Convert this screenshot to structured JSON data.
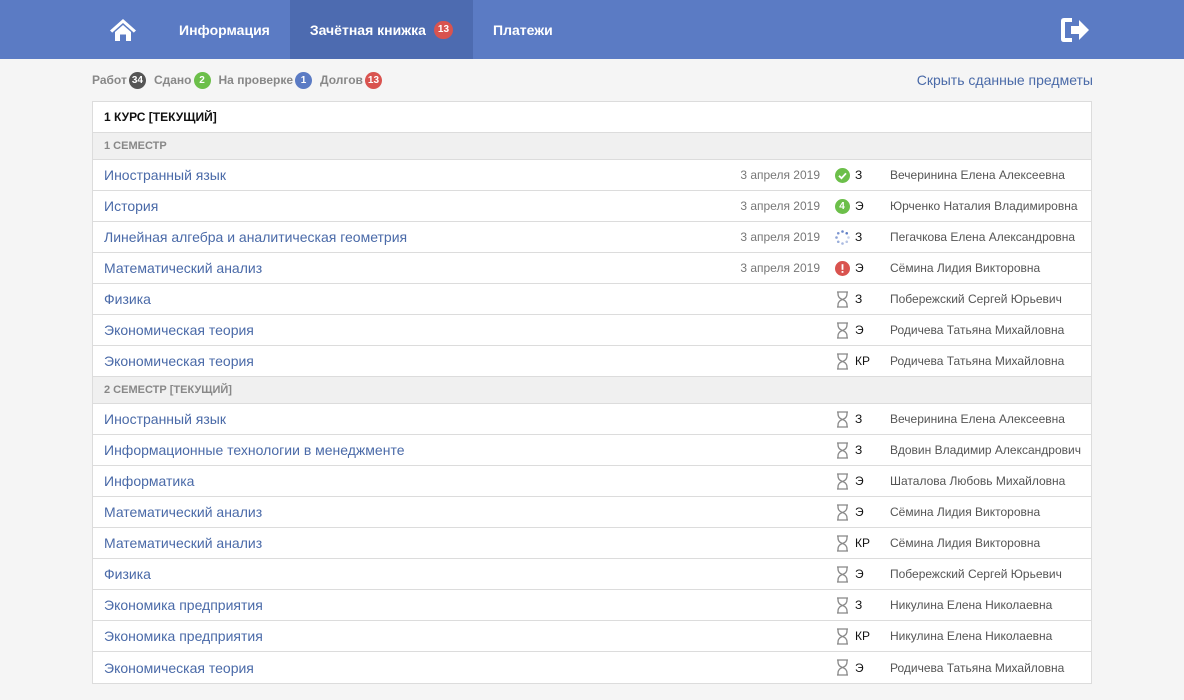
{
  "nav": {
    "home_icon": "home-icon",
    "tabs": [
      {
        "label": "Информация"
      },
      {
        "label": "Зачётная книжка",
        "badge": "13",
        "active": true
      },
      {
        "label": "Платежи"
      }
    ],
    "logout_icon": "logout-icon"
  },
  "stats": {
    "works": {
      "label": "Работ",
      "count": "34"
    },
    "passed": {
      "label": "Сдано",
      "count": "2"
    },
    "review": {
      "label": "На проверке",
      "count": "1"
    },
    "debts": {
      "label": "Долгов",
      "count": "13"
    },
    "hide_link": "Скрыть сданные предметы"
  },
  "colors": {
    "topbar": "#5b7bc4",
    "active_tab": "#4d6bb0",
    "link": "#4a6aa8",
    "works": "#555555",
    "passed": "#6cbf4a",
    "review": "#5b7bc4",
    "debts": "#d9534f"
  },
  "course": {
    "title": "1 КУРС [ТЕКУЩИЙ]",
    "semesters": [
      {
        "title": "1 СЕМЕСТР",
        "rows": [
          {
            "subject": "Иностранный язык",
            "date": "3 апреля 2019",
            "status": "passed-check",
            "type": "З",
            "teacher": "Вечеринина Елена Алексеевна"
          },
          {
            "subject": "История",
            "date": "3 апреля 2019",
            "status": "grade",
            "grade": "4",
            "type": "Э",
            "teacher": "Юрченко Наталия Владимировна"
          },
          {
            "subject": "Линейная алгебра и аналитическая геометрия",
            "date": "3 апреля 2019",
            "status": "review",
            "type": "З",
            "teacher": "Пегачкова Елена Александровна"
          },
          {
            "subject": "Математический анализ",
            "date": "3 апреля 2019",
            "status": "failed",
            "type": "Э",
            "teacher": "Сёмина Лидия Викторовна"
          },
          {
            "subject": "Физика",
            "date": "",
            "status": "pending",
            "type": "З",
            "teacher": "Побережский Сергей Юрьевич"
          },
          {
            "subject": "Экономическая теория",
            "date": "",
            "status": "pending",
            "type": "Э",
            "teacher": "Родичева Татьяна Михайловна"
          },
          {
            "subject": "Экономическая теория",
            "date": "",
            "status": "pending",
            "type": "КР",
            "teacher": "Родичева Татьяна Михайловна"
          }
        ]
      },
      {
        "title": "2 СЕМЕСТР [ТЕКУЩИЙ]",
        "rows": [
          {
            "subject": "Иностранный язык",
            "date": "",
            "status": "pending",
            "type": "З",
            "teacher": "Вечеринина Елена Алексеевна"
          },
          {
            "subject": "Информационные технологии в менеджменте",
            "date": "",
            "status": "pending",
            "type": "З",
            "teacher": "Вдовин Владимир Александрович"
          },
          {
            "subject": "Информатика",
            "date": "",
            "status": "pending",
            "type": "Э",
            "teacher": "Шаталова Любовь Михайловна"
          },
          {
            "subject": "Математический анализ",
            "date": "",
            "status": "pending",
            "type": "Э",
            "teacher": "Сёмина Лидия Викторовна"
          },
          {
            "subject": "Математический анализ",
            "date": "",
            "status": "pending",
            "type": "КР",
            "teacher": "Сёмина Лидия Викторовна"
          },
          {
            "subject": "Физика",
            "date": "",
            "status": "pending",
            "type": "Э",
            "teacher": "Побережский Сергей Юрьевич"
          },
          {
            "subject": "Экономика предприятия",
            "date": "",
            "status": "pending",
            "type": "З",
            "teacher": "Никулина Елена Николаевна"
          },
          {
            "subject": "Экономика предприятия",
            "date": "",
            "status": "pending",
            "type": "КР",
            "teacher": "Никулина Елена Николаевна"
          },
          {
            "subject": "Экономическая теория",
            "date": "",
            "status": "pending",
            "type": "Э",
            "teacher": "Родичева Татьяна Михайловна"
          }
        ]
      }
    ]
  }
}
